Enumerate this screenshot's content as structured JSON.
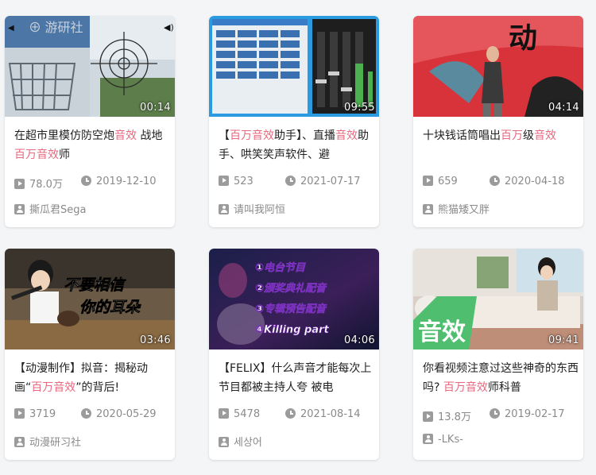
{
  "colors": {
    "highlight": "#e86a7f",
    "meta_text": "#8a8a8a",
    "title_text": "#212121"
  },
  "icons": {
    "views": "play-count-icon",
    "date": "clock-icon",
    "author": "user-icon"
  },
  "cards": [
    {
      "duration": "00:14",
      "title_parts": [
        {
          "text": "在超市里模仿防空炮",
          "hl": false
        },
        {
          "text": "音效",
          "hl": true
        },
        {
          "text": " 战地",
          "hl": false
        },
        {
          "text": "百万音效",
          "hl": true
        },
        {
          "text": "师",
          "hl": false
        }
      ],
      "views": "78.0万",
      "date": "2019-12-10",
      "author": "撕瓜君Sega",
      "thumb_text": ""
    },
    {
      "duration": "09:55",
      "title_parts": [
        {
          "text": "【",
          "hl": false
        },
        {
          "text": "百万音效",
          "hl": true
        },
        {
          "text": "助手】、直播",
          "hl": false
        },
        {
          "text": "音效",
          "hl": true
        },
        {
          "text": "助手、哄笑笑声软件、避",
          "hl": false
        }
      ],
      "views": "523",
      "date": "2021-07-17",
      "author": "请叫我阿恒",
      "thumb_text": ""
    },
    {
      "duration": "04:14",
      "title_parts": [
        {
          "text": "十块钱话筒唱出",
          "hl": false
        },
        {
          "text": "百万",
          "hl": true
        },
        {
          "text": "级",
          "hl": false
        },
        {
          "text": "音效",
          "hl": true
        }
      ],
      "views": "659",
      "date": "2020-04-18",
      "author": "熊猫矮又胖",
      "thumb_text": "动"
    },
    {
      "duration": "03:46",
      "title_parts": [
        {
          "text": "【动漫制作】拟音：揭秘动画“",
          "hl": false
        },
        {
          "text": "百万音效",
          "hl": true
        },
        {
          "text": "”的背后!",
          "hl": false
        }
      ],
      "views": "3719",
      "date": "2020-05-29",
      "author": "动漫研习社",
      "thumb_text": [
        "不要相信",
        "你的耳朵"
      ]
    },
    {
      "duration": "04:06",
      "title_parts": [
        {
          "text": "【FELIX】什么声音才能每次上节目都被主持人夸 被电",
          "hl": false
        }
      ],
      "views": "5478",
      "date": "2021-08-14",
      "author": "세상어",
      "thumb_text": [
        "①电台节目",
        "②颁奖典礼配音",
        "③专辑预告配音",
        "④Killing part"
      ]
    },
    {
      "duration": "09:41",
      "title_parts": [
        {
          "text": "你看视频注意过这些神奇的东西吗? ",
          "hl": false
        },
        {
          "text": "百万音效",
          "hl": true
        },
        {
          "text": "师科普",
          "hl": false
        }
      ],
      "views": "13.8万",
      "date": "2019-02-17",
      "author": "-LKs-",
      "thumb_text": "音效"
    }
  ]
}
